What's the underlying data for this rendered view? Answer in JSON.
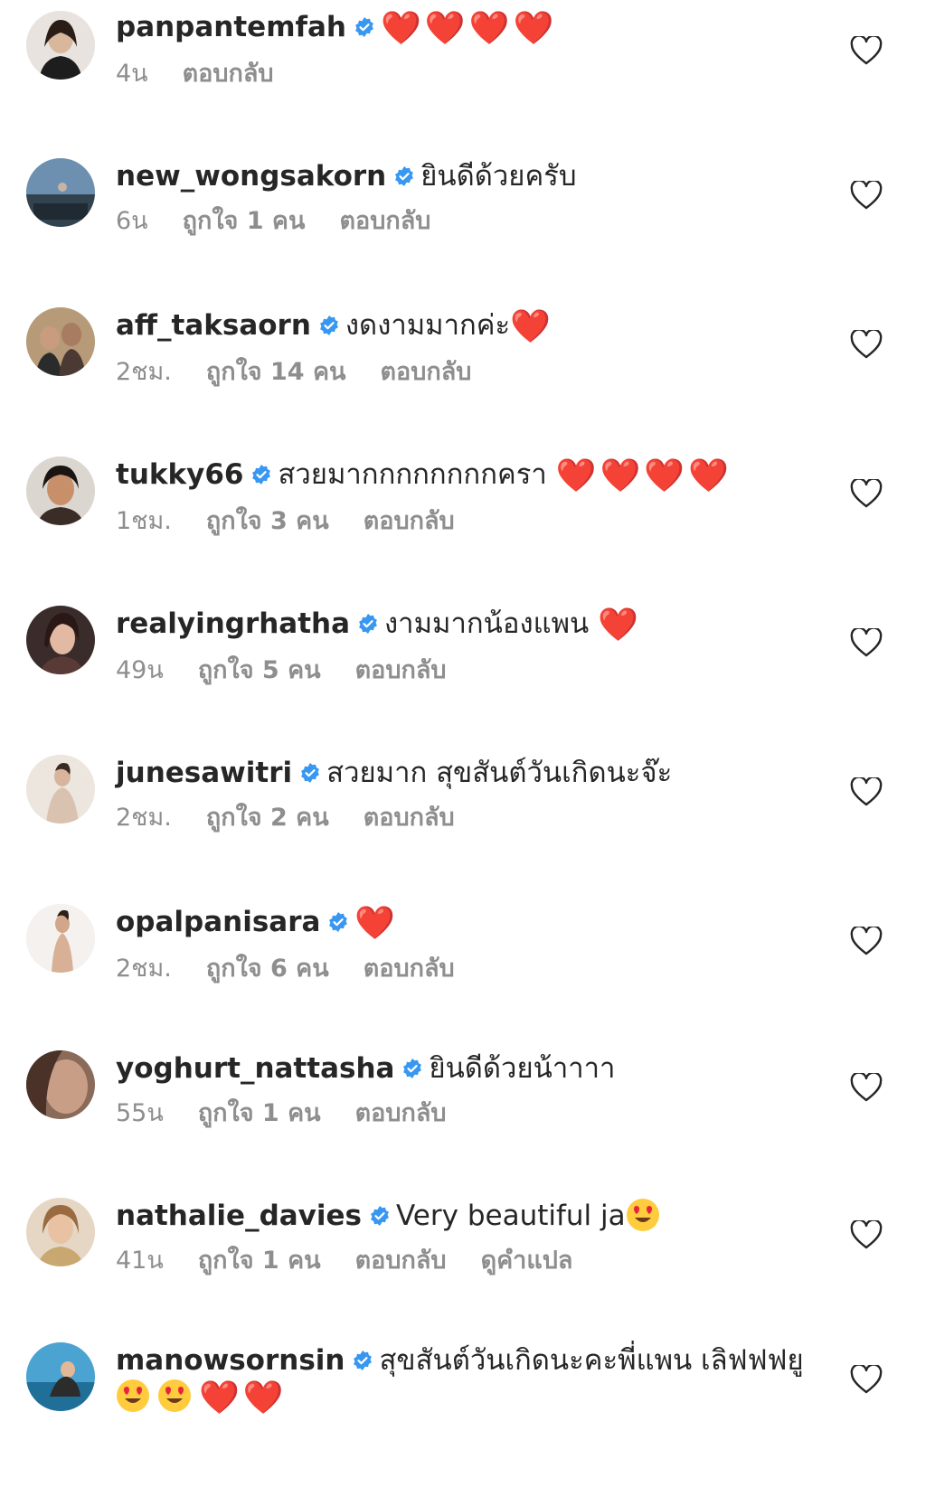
{
  "comments": [
    {
      "username": "panpantemfah",
      "text": "",
      "emojis": "❤️❤️❤️❤️",
      "time": "4น",
      "likes": "",
      "reply": "ตอบกลับ",
      "translate": ""
    },
    {
      "username": "new_wongsakorn",
      "text": "ยินดีด้วยครับ",
      "emojis": "",
      "time": "6น",
      "likes": "ถูกใจ 1 คน",
      "reply": "ตอบกลับ",
      "translate": ""
    },
    {
      "username": "aff_taksaorn",
      "text": "งดงามมากค่ะ",
      "emojis": "❤️",
      "time": "2ชม.",
      "likes": "ถูกใจ 14 คน",
      "reply": "ตอบกลับ",
      "translate": ""
    },
    {
      "username": "tukky66",
      "text": "สวยมากกกกกกกกครา",
      "emojis": "❤️❤️❤️❤️",
      "time": "1ชม.",
      "likes": "ถูกใจ 3 คน",
      "reply": "ตอบกลับ",
      "translate": ""
    },
    {
      "username": "realyingrhatha",
      "text": "งามมากน้องแพน",
      "emojis": "❤️",
      "time": "49น",
      "likes": "ถูกใจ 5 คน",
      "reply": "ตอบกลับ",
      "translate": ""
    },
    {
      "username": "junesawitri",
      "text": "สวยมาก สุขสันต์วันเกิดนะจ๊ะ",
      "emojis": "",
      "time": "2ชม.",
      "likes": "ถูกใจ 2 คน",
      "reply": "ตอบกลับ",
      "translate": ""
    },
    {
      "username": "opalpanisara",
      "text": "",
      "emojis": "❤️",
      "time": "2ชม.",
      "likes": "ถูกใจ 6 คน",
      "reply": "ตอบกลับ",
      "translate": ""
    },
    {
      "username": "yoghurt_nattasha",
      "text": "ยินดีด้วยน้าาาา",
      "emojis": "",
      "time": "55น",
      "likes": "ถูกใจ 1 คน",
      "reply": "ตอบกลับ",
      "translate": ""
    },
    {
      "username": "nathalie_davies",
      "text": "Very beautiful ja",
      "emojis": "",
      "time": "41น",
      "likes": "ถูกใจ 1 คน",
      "reply": "ตอบกลับ",
      "translate": "ดูคำแปล"
    },
    {
      "username": "manowsornsin",
      "text": "สุขสันต์วันเกิดนะคะพี่แพน เลิฟฟฟยู",
      "emojis": "❤️❤️",
      "time": "",
      "likes": "",
      "reply": "",
      "translate": ""
    }
  ],
  "icons": {
    "verified": "verified-badge-icon",
    "like": "heart-outline-icon",
    "smile": "heart-eyes-emoji"
  },
  "colors": {
    "verified": "#3897f0",
    "meta_text": "#8e8e8e",
    "heart": "#ed1c24"
  }
}
